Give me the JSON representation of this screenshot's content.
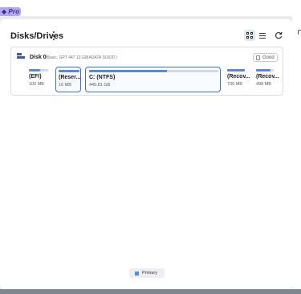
{
  "app": {
    "edition_badge": "Pro"
  },
  "header": {
    "title": "Disks/Drives"
  },
  "toolbar": {
    "view_grid_icon": "grid-view-icon",
    "view_list_icon": "list-view-icon",
    "refresh_icon": "refresh-icon"
  },
  "disk": {
    "name": "Disk 0",
    "detail": "(Basic, GPT 447.13 GB|ADATA SU630 )",
    "status": "Good",
    "partitions": [
      {
        "label": "(EFI)",
        "size": "100 MB",
        "used_fraction": 0.6,
        "selected": false
      },
      {
        "label": "(Reser...",
        "size": "16 MB",
        "used_fraction": 1.0,
        "selected": true
      },
      {
        "label": "C: (NTFS)",
        "size": "445.81 GB",
        "used_fraction": 0.6,
        "selected": true
      },
      {
        "label": "(Recov...",
        "size": "735 MB",
        "used_fraction": 1.0,
        "selected": false
      },
      {
        "label": "(Recov...",
        "size": "498 MB",
        "used_fraction": 0.8,
        "selected": false
      }
    ]
  },
  "legend": {
    "primary": "Primary"
  },
  "colors": {
    "accent": "#3f6fbf",
    "partition_fill": "#5a89d6",
    "pro_badge": "#b7a7f2"
  }
}
